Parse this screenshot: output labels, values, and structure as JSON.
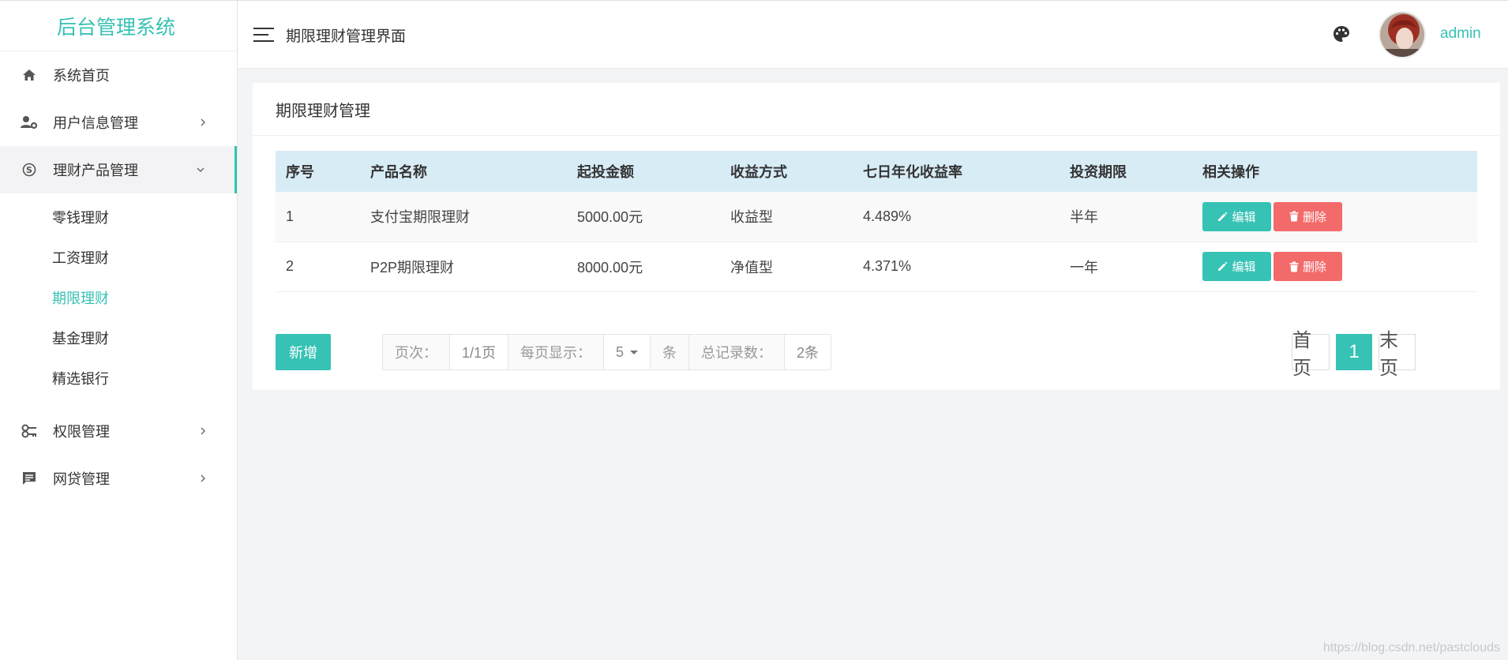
{
  "sidebar": {
    "brand": "后台管理系统",
    "items": [
      {
        "label": "系统首页",
        "icon": "home-icon"
      },
      {
        "label": "用户信息管理",
        "icon": "user-gear-icon"
      },
      {
        "label": "理财产品管理",
        "icon": "skype-icon"
      },
      {
        "label": "权限管理",
        "icon": "key-icon"
      },
      {
        "label": "网贷管理",
        "icon": "message-icon"
      }
    ],
    "submenu": [
      {
        "label": "零钱理财"
      },
      {
        "label": "工资理财"
      },
      {
        "label": "期限理财"
      },
      {
        "label": "基金理财"
      },
      {
        "label": "精选银行"
      }
    ]
  },
  "header": {
    "title": "期限理财管理界面",
    "username": "admin"
  },
  "card": {
    "title": "期限理财管理"
  },
  "table": {
    "headers": [
      "序号",
      "产品名称",
      "起投金额",
      "收益方式",
      "七日年化收益率",
      "投资期限",
      "相关操作"
    ],
    "rows": [
      [
        "1",
        "支付宝期限理财",
        "5000.00元",
        "收益型",
        "4.489%",
        "半年"
      ],
      [
        "2",
        "P2P期限理财",
        "8000.00元",
        "净值型",
        "4.371%",
        "一年"
      ]
    ],
    "edit_label": "编辑",
    "delete_label": "删除"
  },
  "footer": {
    "add_label": "新增",
    "page_label": "页次：",
    "page_value": "1/1页",
    "per_page_label": "每页显示：",
    "per_page_value": "5",
    "unit_label": "条",
    "total_label": "总记录数：",
    "total_value": "2条"
  },
  "pagination": {
    "first": "首页",
    "current": "1",
    "last": "末页"
  },
  "watermark": "https://blog.csdn.net/pastclouds",
  "colors": {
    "accent": "#36c2b4",
    "danger": "#f36a6a",
    "table_header": "#d8ecf6"
  }
}
